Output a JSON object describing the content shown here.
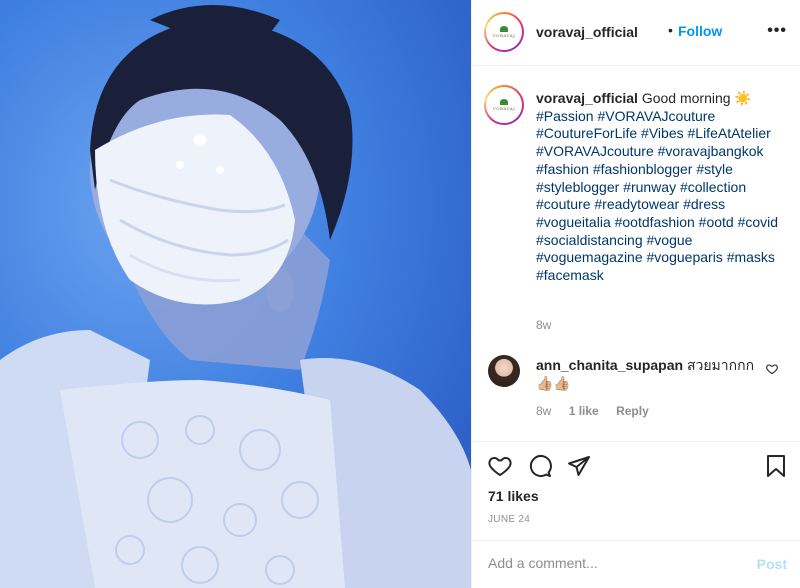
{
  "post": {
    "author": "voravaj_official",
    "avatar_label": "VORAVAJ",
    "follow_label": "Follow",
    "separator": "•",
    "more_label": "•••",
    "caption_text": "Good morning ☀️",
    "hashtags": "#Passion #VORAVAJcouture #CoutureForLife #Vibes #LifeAtAtelier #VORAVAJcouture #voravajbangkok #fashion #fashionblogger #style #styleblogger #runway #collection #couture #readytowear #dress #vogueitalia #ootdfashion #ootd #covid #socialdistancing #vogue #voguemagazine #vogueparis #masks #facemask",
    "caption_age": "8w"
  },
  "comment": {
    "author": "ann_chanita_supapan",
    "text": "สวยมากกก👍🏼👍🏼",
    "age": "8w",
    "likes": "1 like",
    "reply_label": "Reply"
  },
  "stats": {
    "likes": "71 likes",
    "date": "JUNE 24"
  },
  "composer": {
    "placeholder": "Add a comment...",
    "post_label": "Post"
  },
  "colors": {
    "accent": "#0095f6",
    "hashtag": "#00376b",
    "muted": "#8e8e8e",
    "photo_bg": "#3f7fe0"
  }
}
